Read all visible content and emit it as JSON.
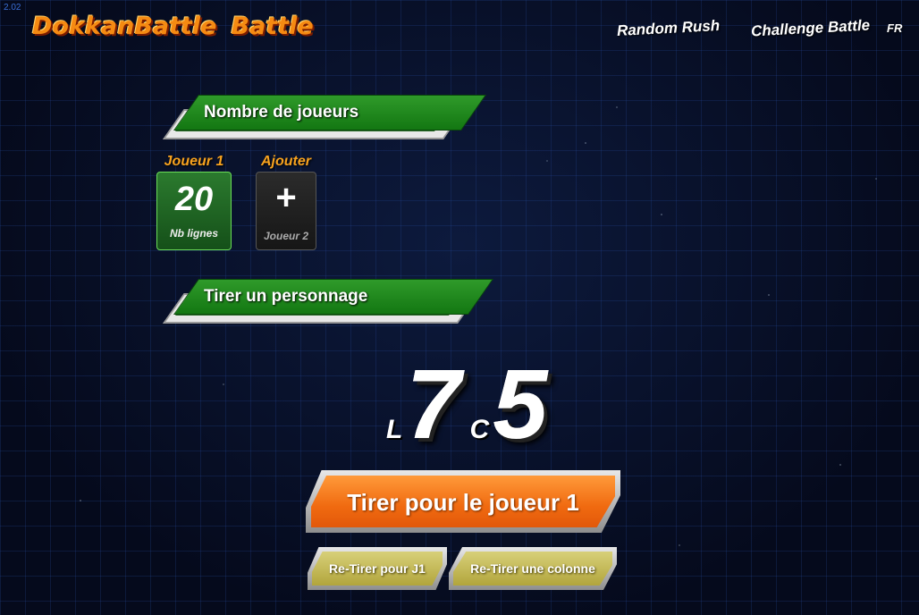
{
  "version": "2.02",
  "header": {
    "logo_word1": "DokkanBattle",
    "logo_word2": "Battle",
    "nav": {
      "random_rush": "Random Rush",
      "challenge_battle": "Challenge Battle",
      "language": "FR"
    }
  },
  "players_section": {
    "title": "Nombre de joueurs",
    "player1": {
      "heading": "Joueur 1",
      "value": "20",
      "sub": "Nb lignes"
    },
    "add": {
      "heading": "Ajouter",
      "symbol": "+",
      "sub": "Joueur 2"
    }
  },
  "draw_section": {
    "title": "Tirer un personnage",
    "line_prefix": "L",
    "line_value": "7",
    "column_prefix": "C",
    "column_value": "5"
  },
  "buttons": {
    "draw_player1": "Tirer pour le joueur 1",
    "redraw_j1": "Re-Tirer pour J1",
    "redraw_column": "Re-Tirer une colonne"
  }
}
